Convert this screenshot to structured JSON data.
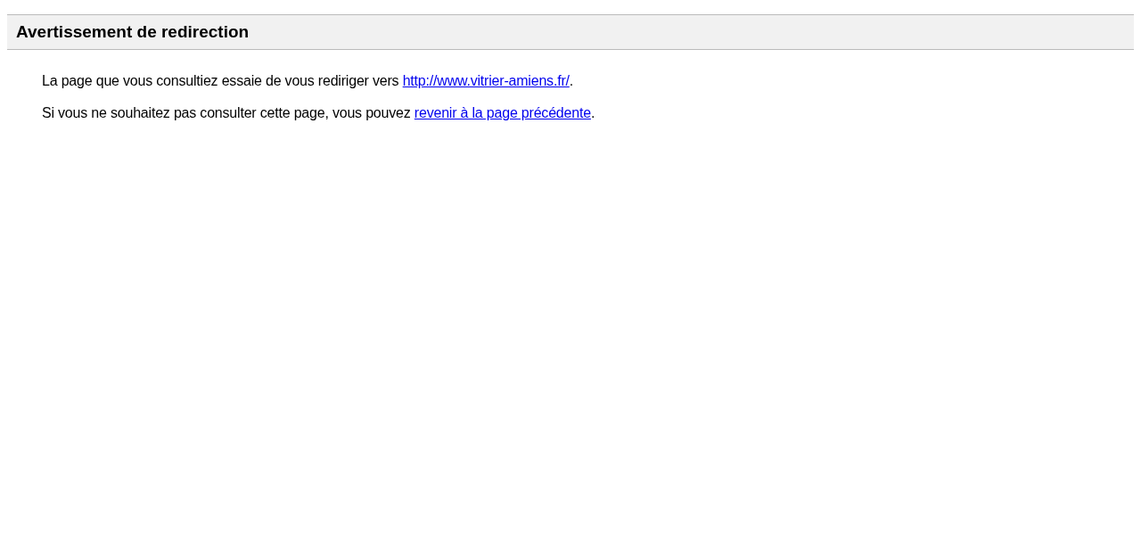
{
  "title": "Avertissement de redirection",
  "paragraphs": [
    {
      "before": "La page que vous consultiez essaie de vous rediriger vers ",
      "link": "http://www.vitrier-amiens.fr/",
      "after": "."
    },
    {
      "before": "Si vous ne souhaitez pas consulter cette page, vous pouvez ",
      "link": "revenir à la page précédente",
      "after": "."
    }
  ]
}
